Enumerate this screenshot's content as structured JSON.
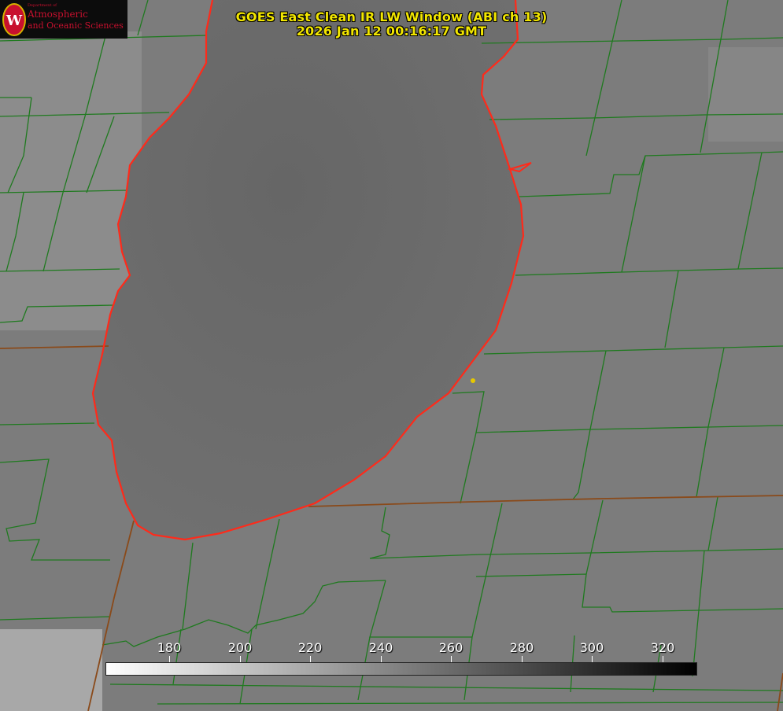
{
  "title": {
    "line1": "GOES East Clean IR LW Window (ABI ch 13)",
    "line2": "2026 Jan 12 00:16:17 GMT"
  },
  "logo": {
    "department": "Department of",
    "line1": "Atmospheric",
    "line2": "and Oceanic Sciences",
    "emblem_letter": "W"
  },
  "colorbar": {
    "tick_labels": [
      "180",
      "200",
      "220",
      "240",
      "260",
      "280",
      "300",
      "320"
    ],
    "colors": {
      "low": "#ffffff",
      "high": "#000000"
    }
  },
  "colors": {
    "title": "#f2e600",
    "county_lines": "#1f7a1f",
    "state_lines": "#8a4a1a",
    "coastline": "#ff2a1a",
    "marker": "#e6c800",
    "lake": "#6b6b6b",
    "land": "#7d7d7d"
  }
}
